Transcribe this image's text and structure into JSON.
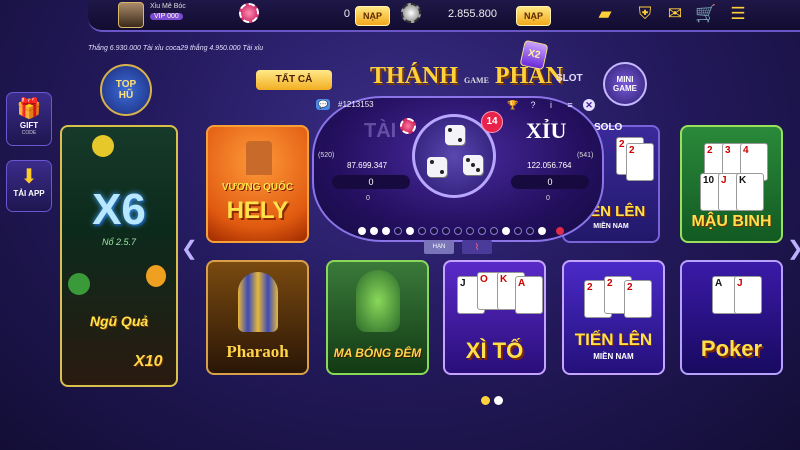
{
  "topbar": {
    "username": "Xỉu Mê Bóc",
    "vip": "VIP 000",
    "balance1": "0",
    "nap1": "NẠP",
    "balance2": "2.855.800",
    "nap2": "NẠP"
  },
  "ticker": "Thắng 6.930.000 Tài xỉu coca29 thắng 4.950.000 Tài xỉu",
  "side": {
    "gift_label": "GIFT",
    "gift_sub": "CODE",
    "taiapp_label": "TẢI APP"
  },
  "tophu": {
    "line1": "TOP",
    "line2": "HŨ"
  },
  "minigame": {
    "line1": "MINI",
    "line2": "GAME"
  },
  "tabs": {
    "all": "TẤT CẢ",
    "slot": "SLOT"
  },
  "logo": {
    "left": "THÁNH",
    "mid": "GAME",
    "right": "PHẦN",
    "badge": "X2"
  },
  "cards": {
    "big": {
      "main": "X6",
      "sub": "Nổ 2.5.7",
      "name": "Ngũ Quả",
      "multiplier": "X10"
    },
    "vuongquoc": {
      "line1": "VƯƠNG QUỐC",
      "line2": "HELY"
    },
    "tienlen_solo": {
      "tag": "SOLO",
      "main": "TIẾN LÊN",
      "sub": "MIỀN NAM"
    },
    "maubinh": {
      "main": "MẬU BINH"
    },
    "pharaoh": {
      "main": "Pharaoh"
    },
    "mabongdem": {
      "main": "MA BÓNG ĐÊM"
    },
    "xito": {
      "main": "XÌ TỐ"
    },
    "tienlen": {
      "main": "TIẾN LÊN",
      "sub": "MIỀN NAM"
    },
    "poker": {
      "main": "Poker"
    }
  },
  "taixiu": {
    "session": "#1213153",
    "timer": "14",
    "tai_label": "TÀI",
    "xiu_label": "XỈU",
    "tai_players": "(520)",
    "xiu_players": "(541)",
    "tai_total": "87.699.347",
    "xiu_total": "122.056.764",
    "tai_bet": "0",
    "xiu_bet": "0",
    "tai_win": "0",
    "xiu_win": "0",
    "han_label": "HẠN",
    "dice": [
      2,
      2,
      3
    ]
  },
  "colors": {
    "accent": "#ffd13a",
    "background": "#241a5e",
    "nap_button": "#f2a81c"
  },
  "pagination": {
    "current": 1,
    "total": 2
  }
}
